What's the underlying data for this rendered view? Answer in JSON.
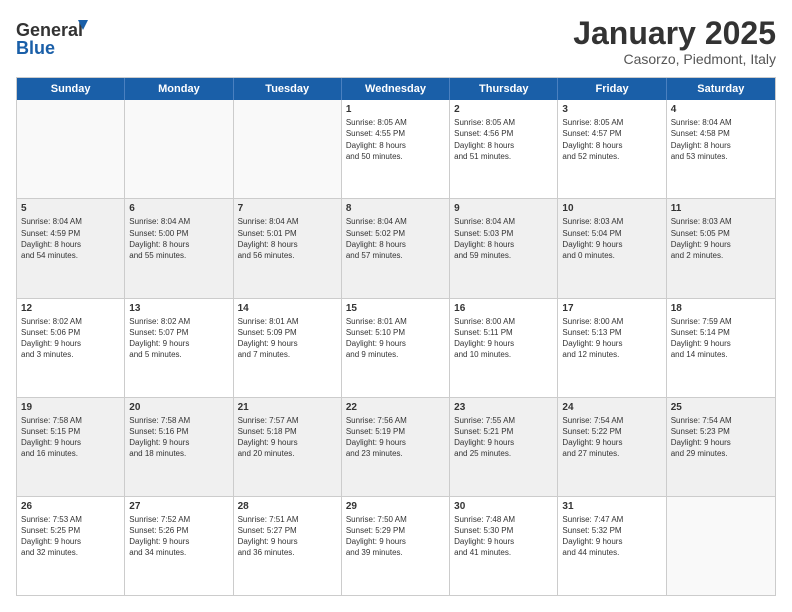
{
  "logo": {
    "line1": "General",
    "line2": "Blue"
  },
  "title": "January 2025",
  "subtitle": "Casorzo, Piedmont, Italy",
  "header": {
    "days": [
      "Sunday",
      "Monday",
      "Tuesday",
      "Wednesday",
      "Thursday",
      "Friday",
      "Saturday"
    ]
  },
  "weeks": [
    [
      {
        "day": "",
        "info": ""
      },
      {
        "day": "",
        "info": ""
      },
      {
        "day": "",
        "info": ""
      },
      {
        "day": "1",
        "info": "Sunrise: 8:05 AM\nSunset: 4:55 PM\nDaylight: 8 hours\nand 50 minutes."
      },
      {
        "day": "2",
        "info": "Sunrise: 8:05 AM\nSunset: 4:56 PM\nDaylight: 8 hours\nand 51 minutes."
      },
      {
        "day": "3",
        "info": "Sunrise: 8:05 AM\nSunset: 4:57 PM\nDaylight: 8 hours\nand 52 minutes."
      },
      {
        "day": "4",
        "info": "Sunrise: 8:04 AM\nSunset: 4:58 PM\nDaylight: 8 hours\nand 53 minutes."
      }
    ],
    [
      {
        "day": "5",
        "info": "Sunrise: 8:04 AM\nSunset: 4:59 PM\nDaylight: 8 hours\nand 54 minutes."
      },
      {
        "day": "6",
        "info": "Sunrise: 8:04 AM\nSunset: 5:00 PM\nDaylight: 8 hours\nand 55 minutes."
      },
      {
        "day": "7",
        "info": "Sunrise: 8:04 AM\nSunset: 5:01 PM\nDaylight: 8 hours\nand 56 minutes."
      },
      {
        "day": "8",
        "info": "Sunrise: 8:04 AM\nSunset: 5:02 PM\nDaylight: 8 hours\nand 57 minutes."
      },
      {
        "day": "9",
        "info": "Sunrise: 8:04 AM\nSunset: 5:03 PM\nDaylight: 8 hours\nand 59 minutes."
      },
      {
        "day": "10",
        "info": "Sunrise: 8:03 AM\nSunset: 5:04 PM\nDaylight: 9 hours\nand 0 minutes."
      },
      {
        "day": "11",
        "info": "Sunrise: 8:03 AM\nSunset: 5:05 PM\nDaylight: 9 hours\nand 2 minutes."
      }
    ],
    [
      {
        "day": "12",
        "info": "Sunrise: 8:02 AM\nSunset: 5:06 PM\nDaylight: 9 hours\nand 3 minutes."
      },
      {
        "day": "13",
        "info": "Sunrise: 8:02 AM\nSunset: 5:07 PM\nDaylight: 9 hours\nand 5 minutes."
      },
      {
        "day": "14",
        "info": "Sunrise: 8:01 AM\nSunset: 5:09 PM\nDaylight: 9 hours\nand 7 minutes."
      },
      {
        "day": "15",
        "info": "Sunrise: 8:01 AM\nSunset: 5:10 PM\nDaylight: 9 hours\nand 9 minutes."
      },
      {
        "day": "16",
        "info": "Sunrise: 8:00 AM\nSunset: 5:11 PM\nDaylight: 9 hours\nand 10 minutes."
      },
      {
        "day": "17",
        "info": "Sunrise: 8:00 AM\nSunset: 5:13 PM\nDaylight: 9 hours\nand 12 minutes."
      },
      {
        "day": "18",
        "info": "Sunrise: 7:59 AM\nSunset: 5:14 PM\nDaylight: 9 hours\nand 14 minutes."
      }
    ],
    [
      {
        "day": "19",
        "info": "Sunrise: 7:58 AM\nSunset: 5:15 PM\nDaylight: 9 hours\nand 16 minutes."
      },
      {
        "day": "20",
        "info": "Sunrise: 7:58 AM\nSunset: 5:16 PM\nDaylight: 9 hours\nand 18 minutes."
      },
      {
        "day": "21",
        "info": "Sunrise: 7:57 AM\nSunset: 5:18 PM\nDaylight: 9 hours\nand 20 minutes."
      },
      {
        "day": "22",
        "info": "Sunrise: 7:56 AM\nSunset: 5:19 PM\nDaylight: 9 hours\nand 23 minutes."
      },
      {
        "day": "23",
        "info": "Sunrise: 7:55 AM\nSunset: 5:21 PM\nDaylight: 9 hours\nand 25 minutes."
      },
      {
        "day": "24",
        "info": "Sunrise: 7:54 AM\nSunset: 5:22 PM\nDaylight: 9 hours\nand 27 minutes."
      },
      {
        "day": "25",
        "info": "Sunrise: 7:54 AM\nSunset: 5:23 PM\nDaylight: 9 hours\nand 29 minutes."
      }
    ],
    [
      {
        "day": "26",
        "info": "Sunrise: 7:53 AM\nSunset: 5:25 PM\nDaylight: 9 hours\nand 32 minutes."
      },
      {
        "day": "27",
        "info": "Sunrise: 7:52 AM\nSunset: 5:26 PM\nDaylight: 9 hours\nand 34 minutes."
      },
      {
        "day": "28",
        "info": "Sunrise: 7:51 AM\nSunset: 5:27 PM\nDaylight: 9 hours\nand 36 minutes."
      },
      {
        "day": "29",
        "info": "Sunrise: 7:50 AM\nSunset: 5:29 PM\nDaylight: 9 hours\nand 39 minutes."
      },
      {
        "day": "30",
        "info": "Sunrise: 7:48 AM\nSunset: 5:30 PM\nDaylight: 9 hours\nand 41 minutes."
      },
      {
        "day": "31",
        "info": "Sunrise: 7:47 AM\nSunset: 5:32 PM\nDaylight: 9 hours\nand 44 minutes."
      },
      {
        "day": "",
        "info": ""
      }
    ]
  ]
}
